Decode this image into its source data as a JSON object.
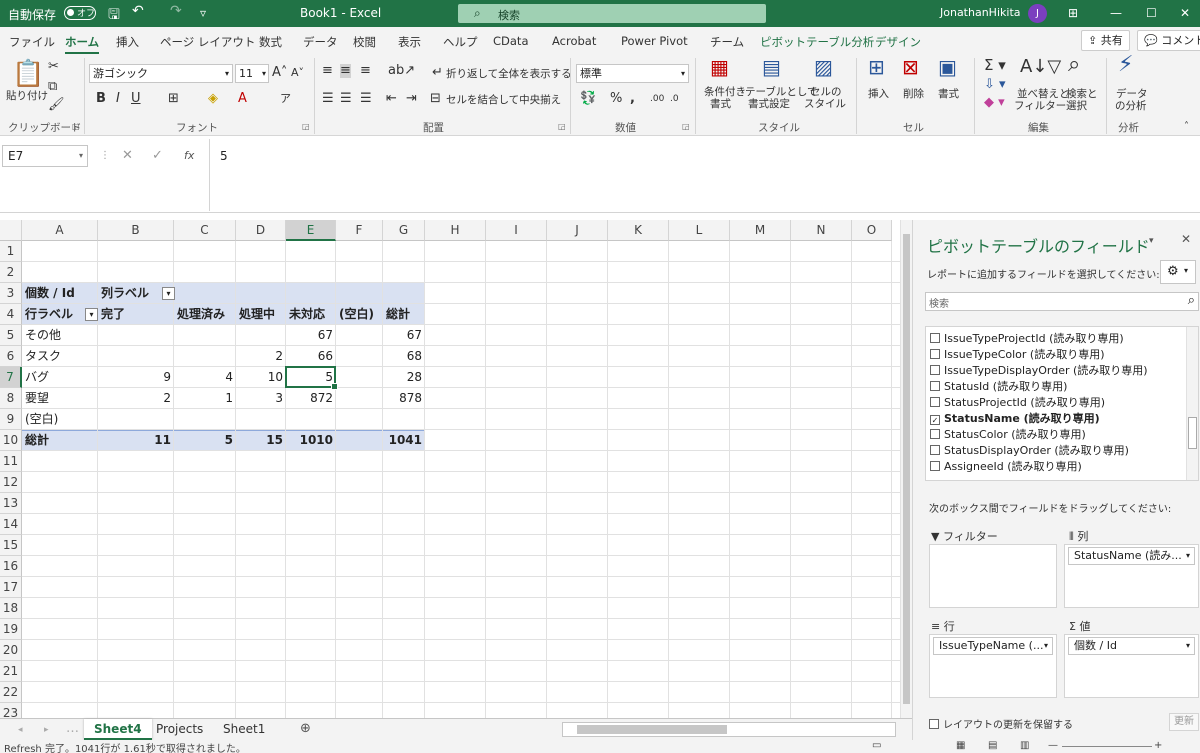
{
  "titlebar": {
    "autosave": "自動保存",
    "autosave_state": "オフ",
    "filename": "Book1 - Excel",
    "search": "検索",
    "user": "JonathanHikita",
    "user_initial": "J"
  },
  "tabs": [
    "ファイル",
    "ホーム",
    "挿入",
    "ページ レイアウト",
    "数式",
    "データ",
    "校閲",
    "表示",
    "ヘルプ",
    "CData",
    "Acrobat",
    "Power Pivot",
    "チーム",
    "ピボットテーブル分析",
    "デザイン"
  ],
  "share_label": "共有",
  "comment_label": "コメント",
  "ribbon": {
    "paste_label": "貼り付け",
    "clipboard_label": "クリップボード",
    "font_name": "游ゴシック",
    "font_size": "11",
    "font_label": "フォント",
    "wrap_label": "折り返して全体を表示する",
    "merge_label": "セルを結合して中央揃え",
    "align_label": "配置",
    "number_format": "標準",
    "number_label": "数値",
    "cond_label1": "条件付き",
    "cond_label2": "書式",
    "table_label1": "テーブルとして",
    "table_label2": "書式設定",
    "cellstyle_label1": "セルの",
    "cellstyle_label2": "スタイル",
    "styles_label": "スタイル",
    "insert_label": "挿入",
    "delete_label": "削除",
    "format_label": "書式",
    "cells_label": "セル",
    "sort_label1": "並べ替えと",
    "sort_label2": "フィルター",
    "find_label1": "検索と",
    "find_label2": "選択",
    "edit_label": "編集",
    "analyze_label1": "データ",
    "analyze_label2": "の分析",
    "analysis_label": "分析"
  },
  "formula_bar": {
    "name_box": "E7",
    "formula": "5"
  },
  "grid": {
    "columns": [
      "A",
      "B",
      "C",
      "D",
      "E",
      "F",
      "G",
      "H",
      "I",
      "J",
      "K",
      "L",
      "M",
      "N",
      "O"
    ],
    "selected_column": "E",
    "selected_row": "7",
    "rows": [
      "1",
      "2",
      "3",
      "4",
      "5",
      "6",
      "7",
      "8",
      "9",
      "10",
      "11",
      "12",
      "13",
      "14",
      "15",
      "16",
      "17",
      "18",
      "19",
      "20",
      "21",
      "22",
      "23"
    ],
    "pivot": {
      "count_label": "個数 / Id",
      "col_label": "列ラベル",
      "row_label": "行ラベル",
      "headers": [
        "完了",
        "処理済み",
        "処理中",
        "未対応",
        "(空白)",
        "総計"
      ],
      "rows": [
        {
          "label": "その他",
          "values": [
            "",
            "",
            "",
            "67",
            "",
            "67"
          ]
        },
        {
          "label": "タスク",
          "values": [
            "",
            "",
            "2",
            "66",
            "",
            "68"
          ]
        },
        {
          "label": "バグ",
          "values": [
            "9",
            "4",
            "10",
            "5",
            "",
            "28"
          ]
        },
        {
          "label": "要望",
          "values": [
            "2",
            "1",
            "3",
            "872",
            "",
            "878"
          ]
        },
        {
          "label": "(空白)",
          "values": [
            "",
            "",
            "",
            "",
            "",
            ""
          ]
        }
      ],
      "total_label": "総計",
      "totals": [
        "11",
        "5",
        "15",
        "1010",
        "",
        "1041"
      ]
    }
  },
  "sheets": [
    "Sheet4",
    "Projects",
    "Sheet1"
  ],
  "status": "Refresh 完了。1041行が 1.61秒で取得されました。",
  "pane": {
    "title": "ピボットテーブルのフィールド",
    "choose_label": "レポートに追加するフィールドを選択してください:",
    "search_placeholder": "検索",
    "fields": [
      {
        "name": "IssueTypeProjectId (読み取り専用)",
        "checked": false
      },
      {
        "name": "IssueTypeColor (読み取り専用)",
        "checked": false
      },
      {
        "name": "IssueTypeDisplayOrder (読み取り専用)",
        "checked": false
      },
      {
        "name": "StatusId (読み取り専用)",
        "checked": false
      },
      {
        "name": "StatusProjectId (読み取り専用)",
        "checked": false
      },
      {
        "name": "StatusName (読み取り専用)",
        "checked": true
      },
      {
        "name": "StatusColor (読み取り専用)",
        "checked": false
      },
      {
        "name": "StatusDisplayOrder (読み取り専用)",
        "checked": false
      },
      {
        "name": "AssigneeId (読み取り専用)",
        "checked": false
      }
    ],
    "drag_label": "次のボックス間でフィールドをドラッグしてください:",
    "filter_label": "フィルター",
    "columns_label": "列",
    "rows_label": "行",
    "values_label": "値",
    "col_chip": "StatusName (読み...",
    "row_chip": "IssueTypeName (...",
    "val_chip": "個数 / Id",
    "defer_label": "レイアウトの更新を保留する",
    "update_label": "更新"
  }
}
